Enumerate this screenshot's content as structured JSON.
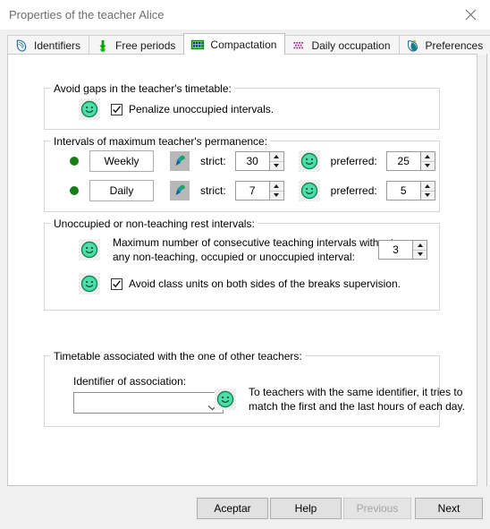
{
  "window": {
    "title": "Properties of the teacher Alice",
    "close_label": "close-icon"
  },
  "tabs": [
    {
      "id": "identifiers",
      "label": "Identifiers",
      "icon": "identifiers-icon",
      "active": false
    },
    {
      "id": "free-periods",
      "label": "Free periods",
      "icon": "down-arrow-icon",
      "active": false
    },
    {
      "id": "compactation",
      "label": "Compactation",
      "icon": "grid-calendar-icon",
      "active": true
    },
    {
      "id": "daily-occupation",
      "label": "Daily occupation",
      "icon": "dots-matrix-icon",
      "active": false
    },
    {
      "id": "preferences",
      "label": "Preferences",
      "icon": "preferences-icon",
      "active": false
    }
  ],
  "groups": {
    "avoid_gaps": {
      "legend": "Avoid gaps in the teacher's timetable:",
      "checkbox": {
        "label": "Penalize unoccupied intervals.",
        "checked": true
      }
    },
    "permanence": {
      "legend": "Intervals of maximum teacher's permanence:",
      "rows": [
        {
          "name": "Weekly",
          "strict_label": "strict:",
          "strict_value": "30",
          "preferred_label": "preferred:",
          "preferred_value": "25"
        },
        {
          "name": "Daily",
          "strict_label": "strict:",
          "strict_value": "7",
          "preferred_label": "preferred:",
          "preferred_value": "5"
        }
      ]
    },
    "rest_intervals": {
      "legend": "Unoccupied or non-teaching rest intervals:",
      "max_consecutive": {
        "line1": "Maximum number of consecutive teaching intervals without",
        "line2": "any non-teaching, occupied or unoccupied interval:",
        "value": "3"
      },
      "avoid_breaks": {
        "label": "Avoid class units on both sides of the breaks supervision.",
        "checked": true
      }
    },
    "association": {
      "legend": "Timetable associated with the one of other teachers:",
      "identifier_label": "Identifier of association:",
      "identifier_value": "",
      "hint_line1": "To teachers with the same identifier, it tries to",
      "hint_line2": "match the first and the last hours of each day."
    }
  },
  "footer": {
    "accept": "Aceptar",
    "help": "Help",
    "previous": "Previous",
    "next": "Next"
  },
  "colors": {
    "smiley_green": "#2fd08a",
    "green_dot": "#158015",
    "tab_active_bg": "#ffffff",
    "window_bg": "#f0f0f0"
  }
}
